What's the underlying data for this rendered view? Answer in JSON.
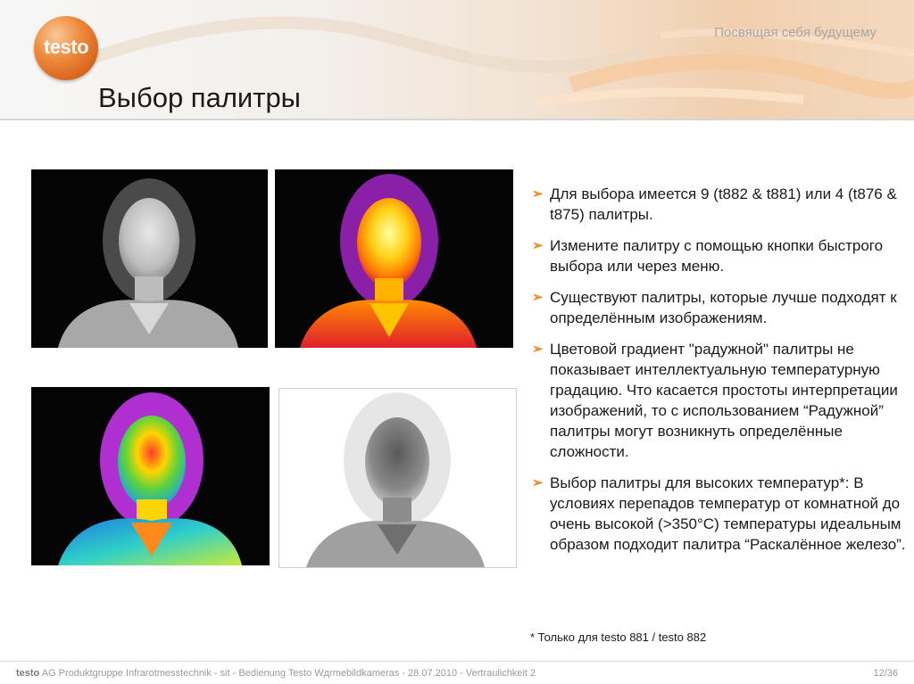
{
  "header": {
    "tagline": "Посвящая себя будущему",
    "logo_text": "testo"
  },
  "slide": {
    "title": "Выбор палитры"
  },
  "bullets": [
    "Для выбора имеется 9 (t882 & t881) или 4 (t876 & t875) палитры.",
    "Измените палитру с помощью кнопки быстрого выбора или через меню.",
    "Существуют палитры, которые лучше подходят к определённым изображениям.",
    "Цветовой градиент \"радужной\" палитры не показывает интеллектуальную температурную градацию. Что касается простоты интерпретации изображений, то с использованием “Радужной” палитры могут возникнуть определённые сложности.",
    "Выбор палитры для высоких температур*: В условиях перепадов температур от комнатной до очень высокой (>350°C) температуры идеальным образом подходит палитра “Раскалённое железо”."
  ],
  "footnote": "* Только для testo 881 / testo 882",
  "footer": {
    "brand": "testo",
    "text": " AG Produktgruppe Infrarotmesstechnik - sit - Bedienung Testo Wдrmebildkameras - 28.07.2010 - Vertraulichkeit 2",
    "page": "12/36"
  },
  "images": [
    {
      "name": "thermal-image-grey-palette",
      "palette": "grey"
    },
    {
      "name": "thermal-image-iron-palette",
      "palette": "iron"
    },
    {
      "name": "thermal-image-rainbow-palette",
      "palette": "rainbow"
    },
    {
      "name": "thermal-image-white-palette",
      "palette": "inverted-grey"
    }
  ],
  "colors": {
    "accent": "#f08a1e",
    "logo": "#e06e22"
  }
}
